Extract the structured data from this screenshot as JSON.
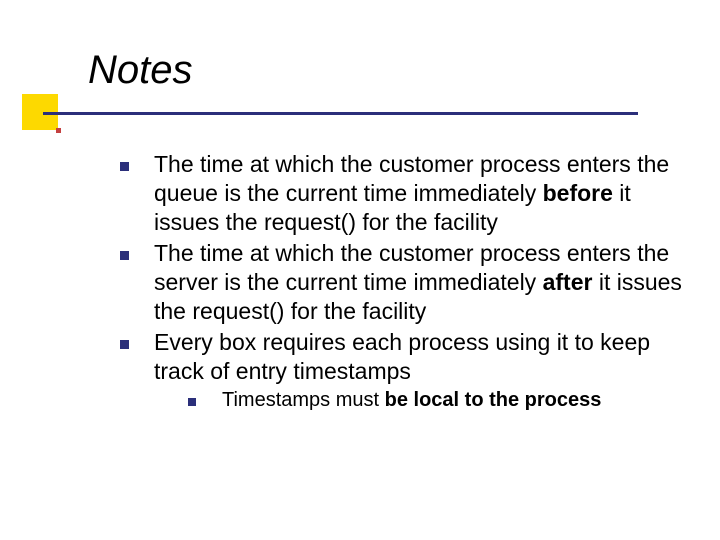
{
  "title": "Notes",
  "bullets": {
    "b1_pre": "The time at which the customer process enters the queue is the current time immediately ",
    "b1_bold": "before",
    "b1_post": " it issues the request() for the facility",
    "b2_pre": "The time at which the customer process enters the server is the current time immediately ",
    "b2_bold": "after",
    "b2_post": " it issues the request() for the facility",
    "b3": "Every box requires each process using it to keep track of entry timestamps",
    "b3_sub_pre": "Timestamps must ",
    "b3_sub_bold": "be local to the process"
  }
}
